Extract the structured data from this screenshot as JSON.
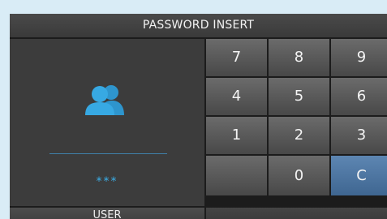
{
  "title": "PASSWORD INSERT",
  "user_panel": {
    "icon": "users-icon",
    "password_mask": "***",
    "user_button_label": "USER"
  },
  "keypad": {
    "keys": [
      "7",
      "8",
      "9",
      "4",
      "5",
      "6",
      "1",
      "2",
      "3",
      "",
      "0",
      "C"
    ]
  },
  "colors": {
    "accent": "#3ab0ea",
    "clear_key": "#4f77a3"
  }
}
